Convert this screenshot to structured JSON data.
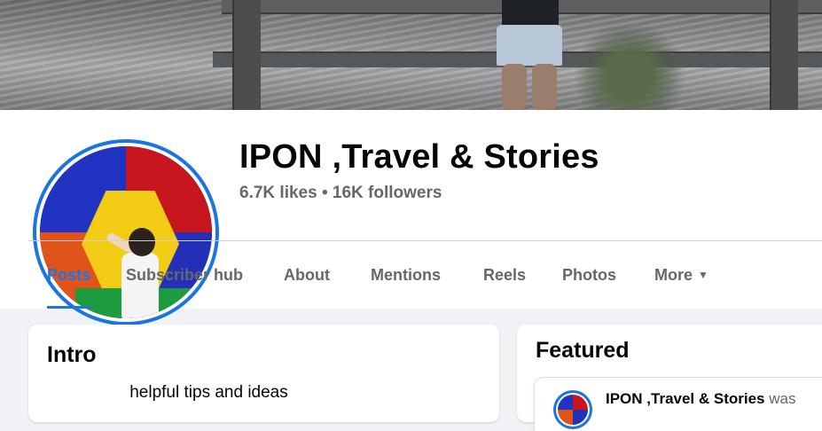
{
  "page": {
    "name": "IPON ,Travel & Stories",
    "stats": "6.7K likes • 16K followers"
  },
  "tabs": [
    {
      "label": "Posts",
      "active": true
    },
    {
      "label": "Subscriber hub",
      "active": false
    },
    {
      "label": "About",
      "active": false
    },
    {
      "label": "Mentions",
      "active": false
    },
    {
      "label": "Reels",
      "active": false
    },
    {
      "label": "Photos",
      "active": false
    },
    {
      "label": "More",
      "active": false,
      "icon": "caret-down-icon"
    }
  ],
  "intro": {
    "title": "Intro",
    "text": "helpful tips and ideas"
  },
  "featured": {
    "title": "Featured",
    "post_author": "IPON ,Travel & Stories",
    "post_suffix": "was"
  },
  "colors": {
    "accent": "#1b74e4",
    "text_primary": "#050505",
    "text_secondary": "#65676b",
    "page_background": "#f0f2f5"
  }
}
